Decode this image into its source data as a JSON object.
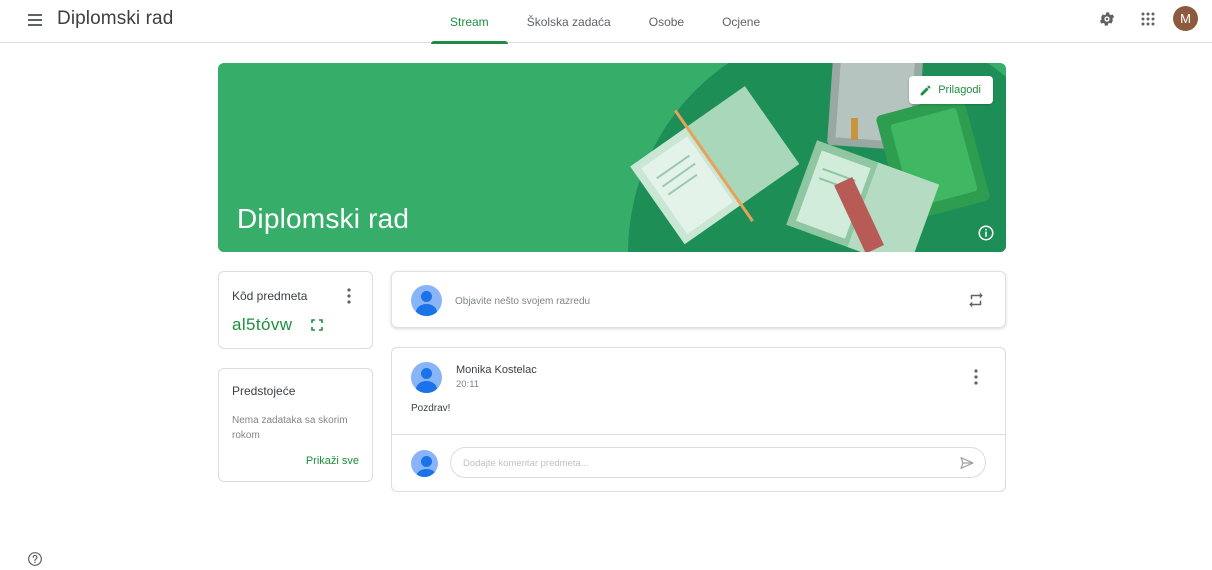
{
  "header": {
    "menu_icon": "hamburger-menu-icon",
    "title": "Diplomski rad",
    "tabs": [
      {
        "label": "Stream",
        "active": true
      },
      {
        "label": "Školska zadaća",
        "active": false
      },
      {
        "label": "Osobe",
        "active": false
      },
      {
        "label": "Ocjene",
        "active": false
      }
    ],
    "settings_icon": "gear-icon",
    "apps_icon": "apps-grid-icon",
    "avatar_initial": "M"
  },
  "banner": {
    "title": "Diplomski rad",
    "customize_label": "Prilagodi",
    "customize_icon": "pencil-icon",
    "info_icon": "info-icon",
    "color": "#37ad6a"
  },
  "class_code": {
    "label": "Kôd predmeta",
    "value": "al5tóvw",
    "fullscreen_icon": "fullscreen-icon",
    "menu_icon": "more-vert-icon"
  },
  "upcoming": {
    "title": "Predstojeće",
    "text": "Nema zadataka sa skorim rokom",
    "link_label": "Prikaži sve"
  },
  "post_box": {
    "placeholder": "Objavite nešto svojem razredu",
    "repost_icon": "repost-icon"
  },
  "announcement": {
    "author": "Monika Kostelac",
    "time": "20:11",
    "body": "Pozdrav!",
    "comment_placeholder": "Dodajte komentar predmeta...",
    "send_icon": "send-icon"
  },
  "footer": {
    "help_icon": "help-icon"
  },
  "colors": {
    "accent": "#1e8e3e",
    "banner_green": "#37ad6a",
    "avatar_brown": "#8d5a3d"
  }
}
